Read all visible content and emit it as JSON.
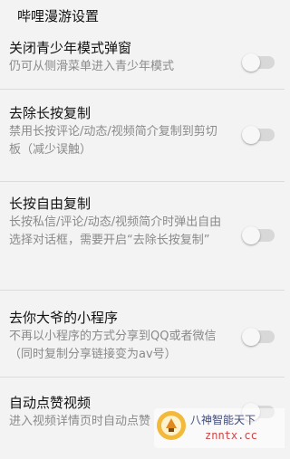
{
  "header": {
    "title": "哔哩漫游设置"
  },
  "items": [
    {
      "title": "关闭青少年模式弹窗",
      "desc": "仍可从侧滑菜单进入青少年模式",
      "enabled": false
    },
    {
      "title": "去除长按复制",
      "desc": "禁用长按评论/动态/视频简介复制到剪切板（减少误触）",
      "enabled": false
    },
    {
      "title": "长按自由复制",
      "desc": "长按私信/评论/动态/视频简介时弹出自由选择对话框，需要开启“去除长按复制”",
      "enabled": false
    },
    {
      "title": "去你大爷的小程序",
      "desc": "不再以小程序的方式分享到QQ或者微信（同时复制分享链接变为av号）",
      "enabled": false
    },
    {
      "title": "自动点赞视频",
      "desc": "进入视频详情页时自动点赞",
      "enabled": false
    }
  ],
  "watermark": {
    "title": "八神智能天下",
    "url": "znntx.cc"
  }
}
